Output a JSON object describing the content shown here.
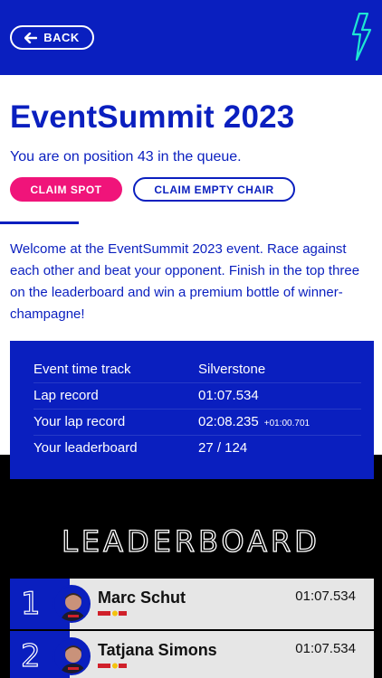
{
  "header": {
    "back_label": "BACK",
    "back_icon": "arrow-left-icon",
    "brand_icon": "lightning-bolt-icon",
    "brand_color": "#0a1fbf",
    "accent_color": "#1ee6d2"
  },
  "event": {
    "title": "EventSummit 2023",
    "queue_text": "You are on position 43 in the queue.",
    "claim_spot_label": "CLAIM SPOT",
    "claim_chair_label": "CLAIM EMPTY CHAIR",
    "intro": "Welcome at the EventSummit 2023 event. Race against each other and beat your opponent. Finish in the top three on the leaderboard and win a premium bottle of winner-champagne!"
  },
  "info": {
    "rows": [
      {
        "label": "Event time track",
        "value": "Silverstone",
        "extra": ""
      },
      {
        "label": "Lap record",
        "value": "01:07.534",
        "extra": ""
      },
      {
        "label": "Your lap record",
        "value": "02:08.235",
        "extra": "+01:00.701"
      },
      {
        "label": "Your leaderboard",
        "value": "27 / 124",
        "extra": ""
      }
    ]
  },
  "leaderboard": {
    "title": "LEADERBOARD",
    "rows": [
      {
        "rank": "1",
        "name": "Marc Schut",
        "time": "01:07.534"
      },
      {
        "rank": "2",
        "name": "Tatjana Simons",
        "time": "01:07.534"
      }
    ]
  },
  "colors": {
    "primary": "#0a1fbf",
    "pink": "#f0147a",
    "black": "#000000",
    "row_bg": "#e6e6e6"
  }
}
